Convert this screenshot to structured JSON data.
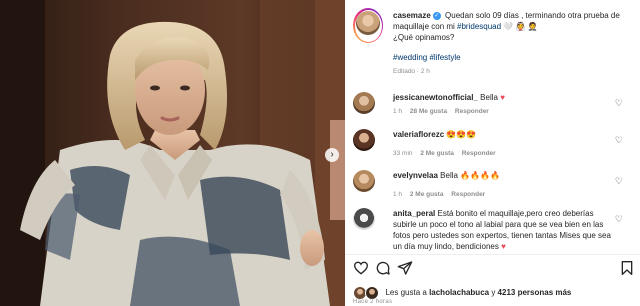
{
  "post": {
    "author": "casemaze",
    "caption_text": "Quedan solo 09 días , terminando otra prueba de maquillaje con mi ",
    "caption_hashtag": "#bridesquad",
    "caption_emoji": "🤍 👰 🤵",
    "caption_line2": "¿Qué opinamos?",
    "tags": "#wedding #lifestyle",
    "edited": "Editado · 2 h"
  },
  "comments": [
    {
      "user": "jessicanewtonofficial_",
      "text": "Bella",
      "emoji": "♥",
      "time": "1 h",
      "likes": "28 Me gusta",
      "reply": "Responder"
    },
    {
      "user": "valeriaflorezc",
      "text": "",
      "emoji": "😍😍😍",
      "time": "33 min",
      "likes": "2 Me gusta",
      "reply": "Responder"
    },
    {
      "user": "evelynvelaa",
      "text": "Bella",
      "emoji": "🔥🔥🔥🔥",
      "time": "1 h",
      "likes": "2 Me gusta",
      "reply": "Responder"
    },
    {
      "user": "anita_peral",
      "text": "Está bonito el maquillaje,pero creo deberías subirle un poco el tono al labial para que se vea bien en las fotos pero ustedes son expertos, tienen tantas Mises que sea un día muy lindo, bendiciones",
      "emoji": "♥",
      "time": "",
      "likes": "",
      "reply": ""
    }
  ],
  "likes_line": {
    "prefix": "Les gusta a ",
    "user": "lacholachabuca",
    "middle": " y ",
    "count": "4213 personas más"
  },
  "time_ago": "Hace 2 horas",
  "icons": {
    "like": "heart-outline-icon",
    "comment": "comment-icon",
    "share": "paper-plane-icon",
    "save": "bookmark-icon",
    "next": "chevron-right-icon"
  },
  "colors": {
    "verified": "#3897f0",
    "hashtag": "#00376b",
    "meta": "#8e8e8e",
    "like_heart": "#ed4956"
  }
}
